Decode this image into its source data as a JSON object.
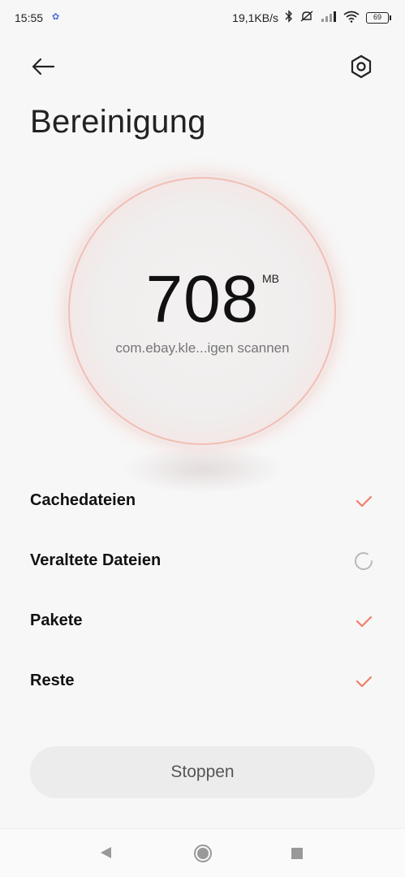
{
  "status_bar": {
    "time": "15:55",
    "net_speed": "19,1KB/s",
    "battery": "69"
  },
  "header": {
    "title": "Bereinigung"
  },
  "scan": {
    "size_value": "708",
    "size_unit": "MB",
    "current_item": "com.ebay.kle...igen scannen"
  },
  "categories": [
    {
      "label": "Cachedateien",
      "status": "done"
    },
    {
      "label": "Veraltete Dateien",
      "status": "scanning"
    },
    {
      "label": "Pakete",
      "status": "done"
    },
    {
      "label": "Reste",
      "status": "done"
    }
  ],
  "actions": {
    "stop_label": "Stoppen"
  },
  "colors": {
    "accent": "#ef7f6b",
    "spinner": "#b8b8b8"
  }
}
